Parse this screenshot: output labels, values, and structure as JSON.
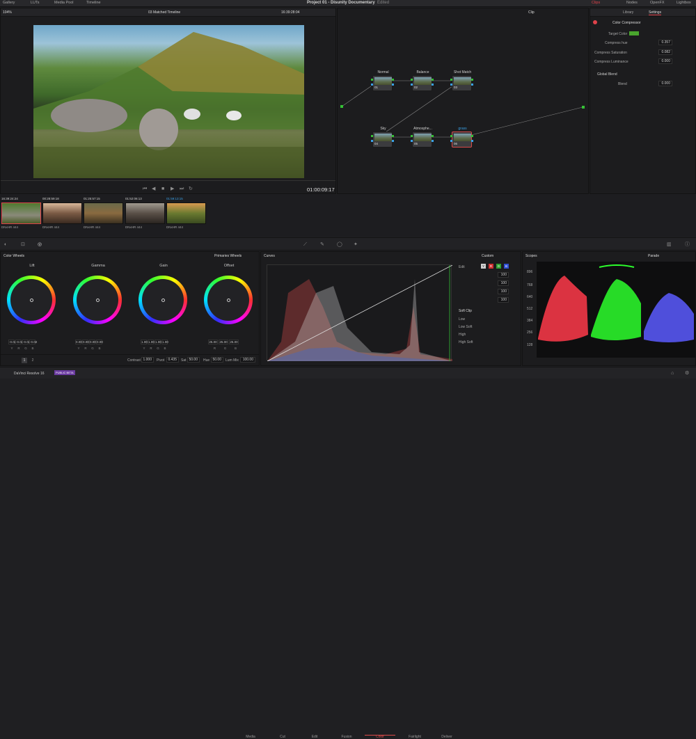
{
  "topbar": {
    "tabs": [
      "Gallery",
      "LUTs",
      "Media Pool",
      "Timeline"
    ],
    "project_title": "Project 01 - Disunity Documentary",
    "status": "Edited",
    "right_tabs": [
      "Clips",
      "Nodes",
      "OpenFX",
      "Lightbox"
    ]
  },
  "viewer": {
    "zoom": "104%",
    "timeline": "03 Matched Timeline",
    "timecode": "16:39:28:04",
    "playhead_timecode": "01:00:09:17"
  },
  "node_editor": {
    "mode": "Clip",
    "nodes": [
      {
        "label": "Normal",
        "num": "01"
      },
      {
        "label": "Balance",
        "num": "02"
      },
      {
        "label": "Shot Match",
        "num": "03"
      },
      {
        "label": "Sky",
        "num": "04"
      },
      {
        "label": "Atmosphe...",
        "num": "05"
      },
      {
        "label": "grass",
        "num": "06"
      }
    ]
  },
  "inspector": {
    "tabs": [
      "Library",
      "Settings"
    ],
    "plugin": "Color Compressor",
    "params": [
      {
        "label": "Target Color"
      },
      {
        "label": "Compress hue",
        "value": "0.357"
      },
      {
        "label": "Compress Saturation",
        "value": "0.082"
      },
      {
        "label": "Compress Luminance",
        "value": "0.000"
      }
    ],
    "section": "Global Blend",
    "blend_label": "Blend",
    "blend_value": "0.000"
  },
  "clips": [
    {
      "id": "01",
      "tc": "16:39:24:24",
      "track": "V1",
      "codec": "DNxHR 444"
    },
    {
      "id": "02",
      "tc": "00:28:59:18",
      "track": "V1",
      "codec": "DNxHR 444"
    },
    {
      "id": "03",
      "tc": "01:25:57:15",
      "track": "V1",
      "codec": "DNxHR 444"
    },
    {
      "id": "04",
      "tc": "01:52:06:13",
      "track": "V1",
      "codec": "DNxHR 444"
    },
    {
      "id": "05",
      "tc": "01:59:13:15",
      "track": "V1",
      "codec": "DNxHR 444"
    }
  ],
  "color_wheels": {
    "title": "Color Wheels",
    "mode": "Primaries Wheels",
    "wheels": [
      {
        "name": "Lift",
        "values": [
          "-0.02",
          "-0.02",
          "-0.02",
          "-0.02"
        ],
        "channels": [
          "Y",
          "R",
          "G",
          "B"
        ]
      },
      {
        "name": "Gamma",
        "values": [
          "0.00",
          "0.00",
          "0.00",
          "0.00"
        ],
        "channels": [
          "Y",
          "R",
          "G",
          "B"
        ]
      },
      {
        "name": "Gain",
        "values": [
          "1.00",
          "1.00",
          "1.00",
          "1.00"
        ],
        "channels": [
          "Y",
          "R",
          "G",
          "B"
        ]
      },
      {
        "name": "Offset",
        "values": [
          "25.00",
          "25.00",
          "25.00"
        ],
        "channels": [
          "R",
          "G",
          "B"
        ]
      }
    ],
    "bottom": {
      "page1": "1",
      "page2": "2",
      "contrast_label": "Contrast",
      "contrast": "1.000",
      "pivot_label": "Pivot",
      "pivot": "0.435",
      "sat_label": "Sat",
      "sat": "50.00",
      "hue_label": "Hue",
      "hue": "50.00",
      "lummix_label": "Lum Mix",
      "lummix": "100.00"
    }
  },
  "curves": {
    "title": "Curves",
    "mode": "Custom",
    "edit_label": "Edit",
    "channel_values": [
      "100",
      "100",
      "100",
      "100"
    ],
    "softclip": "Soft Clip",
    "softclip_rows": [
      "Low",
      "Low Soft",
      "High",
      "High Soft"
    ]
  },
  "scopes": {
    "title": "Scopes",
    "mode": "Parade",
    "ticks": [
      "896",
      "768",
      "640",
      "512",
      "384",
      "256",
      "128"
    ]
  },
  "pages": [
    "Media",
    "Cut",
    "Edit",
    "Fusion",
    "Color",
    "Fairlight",
    "Deliver"
  ],
  "footer": {
    "app": "DaVinci Resolve 16",
    "badge": "PUBLIC BETA"
  },
  "colors": {
    "accent": "#e0424a",
    "active_page": "#e04a4a",
    "target_swatch": "#49a52d"
  }
}
